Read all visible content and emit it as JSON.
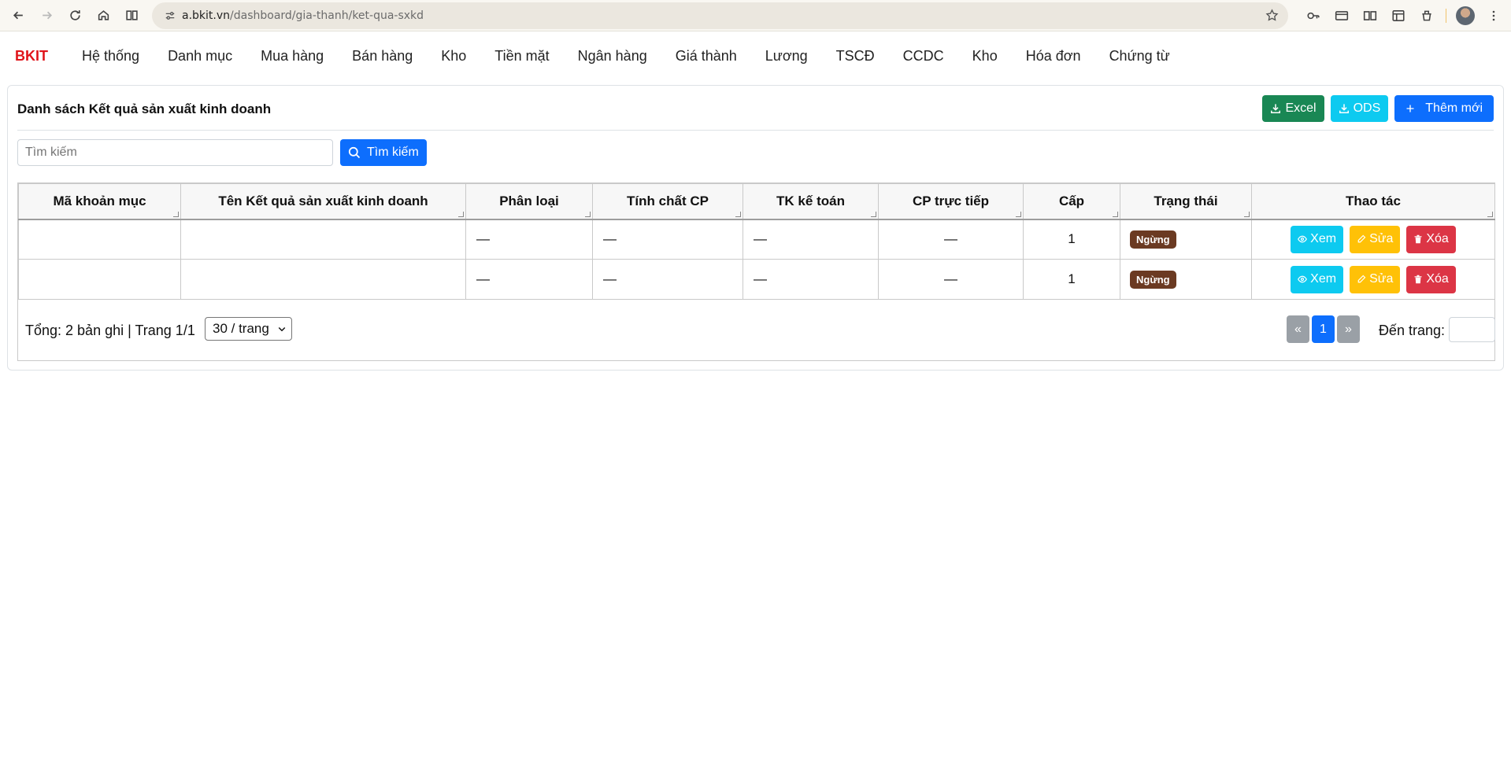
{
  "browser": {
    "url_host": "a.bkit.vn",
    "url_path": "/dashboard/gia-thanh/ket-qua-sxkd"
  },
  "app": {
    "brand": "BKIT",
    "menu": [
      "Hệ thống",
      "Danh mục",
      "Mua hàng",
      "Bán hàng",
      "Kho",
      "Tiền mặt",
      "Ngân hàng",
      "Giá thành",
      "Lương",
      "TSCĐ",
      "CCDC",
      "Kho",
      "Hóa đơn",
      "Chứng từ"
    ]
  },
  "page": {
    "title": "Danh sách Kết quả sản xuất kinh doanh",
    "excel_label": "Excel",
    "ods_label": "ODS",
    "add_label": "Thêm mới",
    "search_placeholder": "Tìm kiếm",
    "search_button": "Tìm kiếm"
  },
  "table": {
    "headers": [
      "Mã khoản mục",
      "Tên Kết quả sản xuất kinh doanh",
      "Phân loại",
      "Tính chất CP",
      "TK kế toán",
      "CP trực tiếp",
      "Cấp",
      "Trạng thái",
      "Thao tác"
    ],
    "rows": [
      {
        "code": "",
        "name": "",
        "type": "—",
        "nature": "—",
        "account": "—",
        "direct": "—",
        "level": "1",
        "status": "Ngừng"
      },
      {
        "code": "",
        "name": "",
        "type": "—",
        "nature": "—",
        "account": "—",
        "direct": "—",
        "level": "1",
        "status": "Ngừng"
      }
    ],
    "action_view": "Xem",
    "action_edit": "Sửa",
    "action_delete": "Xóa"
  },
  "footer": {
    "summary": "Tổng: 2 bản ghi | Trang 1/1",
    "page_size": "30 / trang",
    "prev": "«",
    "current_page": "1",
    "next": "»",
    "goto_label": "Đến trang:"
  },
  "colors": {
    "brand": "#e0141a",
    "primary": "#0d6efd",
    "success": "#198754",
    "info": "#0dcaf0",
    "warning": "#ffc107",
    "danger": "#dc3545",
    "status_badge": "#6b3a22"
  }
}
